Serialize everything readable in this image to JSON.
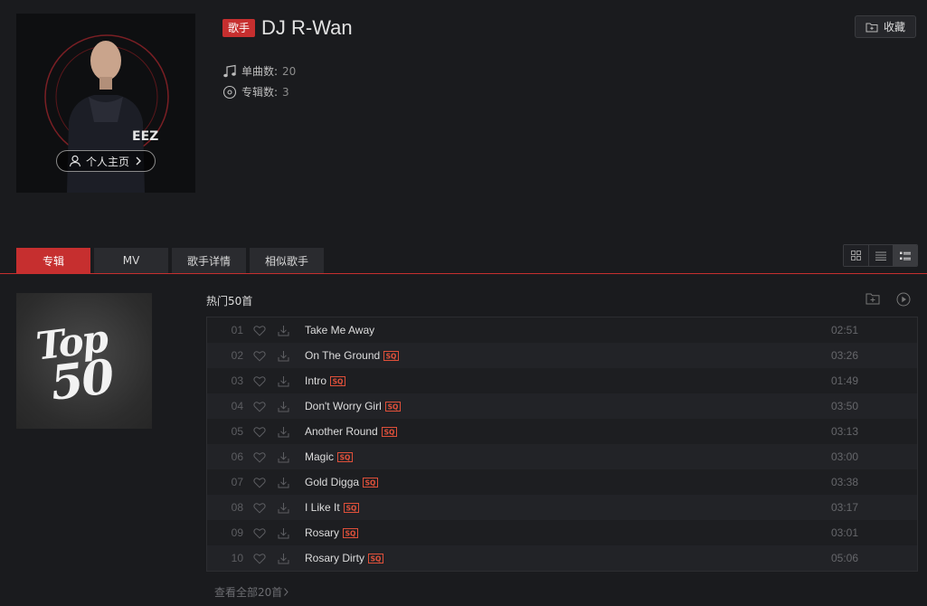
{
  "artist": {
    "badge": "歌手",
    "name": "DJ R-Wan",
    "home_button": "个人主页",
    "collect_button": "收藏",
    "stats": [
      {
        "label": "单曲数:",
        "value": "20",
        "icon": "music-note-icon"
      },
      {
        "label": "专辑数:",
        "value": "3",
        "icon": "disc-icon"
      }
    ]
  },
  "tabs": [
    {
      "label": "专辑",
      "active": true
    },
    {
      "label": "MV",
      "active": false
    },
    {
      "label": "歌手详情",
      "active": false
    },
    {
      "label": "相似歌手",
      "active": false
    }
  ],
  "view_modes": [
    "grid-view-icon",
    "list-view-icon",
    "detail-list-view-icon"
  ],
  "album": {
    "cover_line1": "Top",
    "cover_line2": "50",
    "title": "热门50首",
    "quality_badge": "SQ",
    "tracks": [
      {
        "no": "01",
        "title": "Take Me Away",
        "sq": false,
        "duration": "02:51"
      },
      {
        "no": "02",
        "title": "On The Ground",
        "sq": true,
        "duration": "03:26"
      },
      {
        "no": "03",
        "title": "Intro",
        "sq": true,
        "duration": "01:49"
      },
      {
        "no": "04",
        "title": "Don't Worry Girl",
        "sq": true,
        "duration": "03:50"
      },
      {
        "no": "05",
        "title": "Another Round",
        "sq": true,
        "duration": "03:13"
      },
      {
        "no": "06",
        "title": "Magic",
        "sq": true,
        "duration": "03:00"
      },
      {
        "no": "07",
        "title": "Gold Digga",
        "sq": true,
        "duration": "03:38"
      },
      {
        "no": "08",
        "title": "I Like It",
        "sq": true,
        "duration": "03:17"
      },
      {
        "no": "09",
        "title": "Rosary",
        "sq": true,
        "duration": "03:01"
      },
      {
        "no": "10",
        "title": "Rosary Dirty",
        "sq": true,
        "duration": "05:06"
      }
    ],
    "view_all": "查看全部20首"
  },
  "colors": {
    "accent": "#c62f2f",
    "background": "#1a1b1e",
    "sq_badge": "#e0503a"
  }
}
